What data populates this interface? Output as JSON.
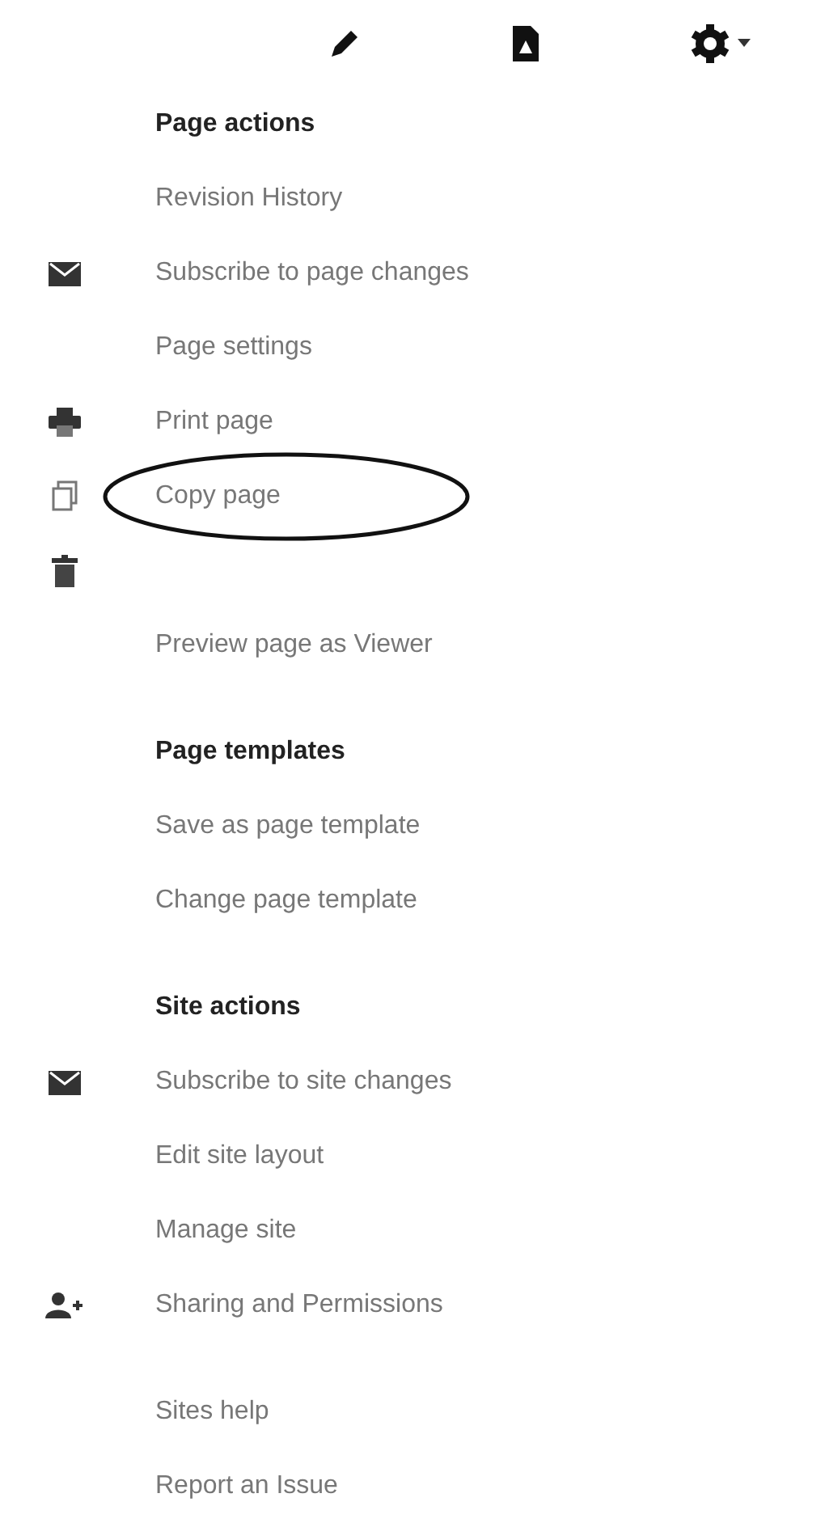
{
  "toolbar": [
    {
      "kind": "pencil"
    },
    {
      "kind": "page"
    },
    {
      "kind": "gear"
    }
  ],
  "sections": [
    {
      "title": "Page actions",
      "items": [
        {
          "label": "Revision History",
          "kind": "plain",
          "highlighted": false
        },
        {
          "label": "Subscribe to page changes",
          "kind": "envelope",
          "highlighted": false
        },
        {
          "label": "Page settings",
          "kind": "plain",
          "highlighted": false
        },
        {
          "label": "Print page",
          "kind": "printer",
          "highlighted": false
        },
        {
          "label": "Copy page",
          "kind": "copy",
          "highlighted": true
        },
        {
          "kind": "trash",
          "highlighted": false
        },
        {
          "label": "Preview page as Viewer",
          "kind": "plain",
          "highlighted": false
        }
      ]
    },
    {
      "title": "Page templates",
      "items": [
        {
          "label": "Save as page template",
          "kind": "plain",
          "highlighted": false
        },
        {
          "label": "Change page template",
          "kind": "plain",
          "highlighted": false
        }
      ]
    },
    {
      "title": "Site actions",
      "items": [
        {
          "label": "Subscribe to site changes",
          "kind": "envelope",
          "highlighted": false
        },
        {
          "label": "Edit site layout",
          "kind": "plain",
          "highlighted": false
        },
        {
          "label": "Manage site",
          "kind": "plain",
          "highlighted": false
        },
        {
          "label": "Sharing and Permissions",
          "kind": "person",
          "highlighted": false
        }
      ]
    },
    {
      "items": [
        {
          "label": "Sites help",
          "kind": "plain",
          "highlighted": false
        },
        {
          "label": "Report an Issue",
          "kind": "plain",
          "highlighted": false
        }
      ]
    }
  ]
}
